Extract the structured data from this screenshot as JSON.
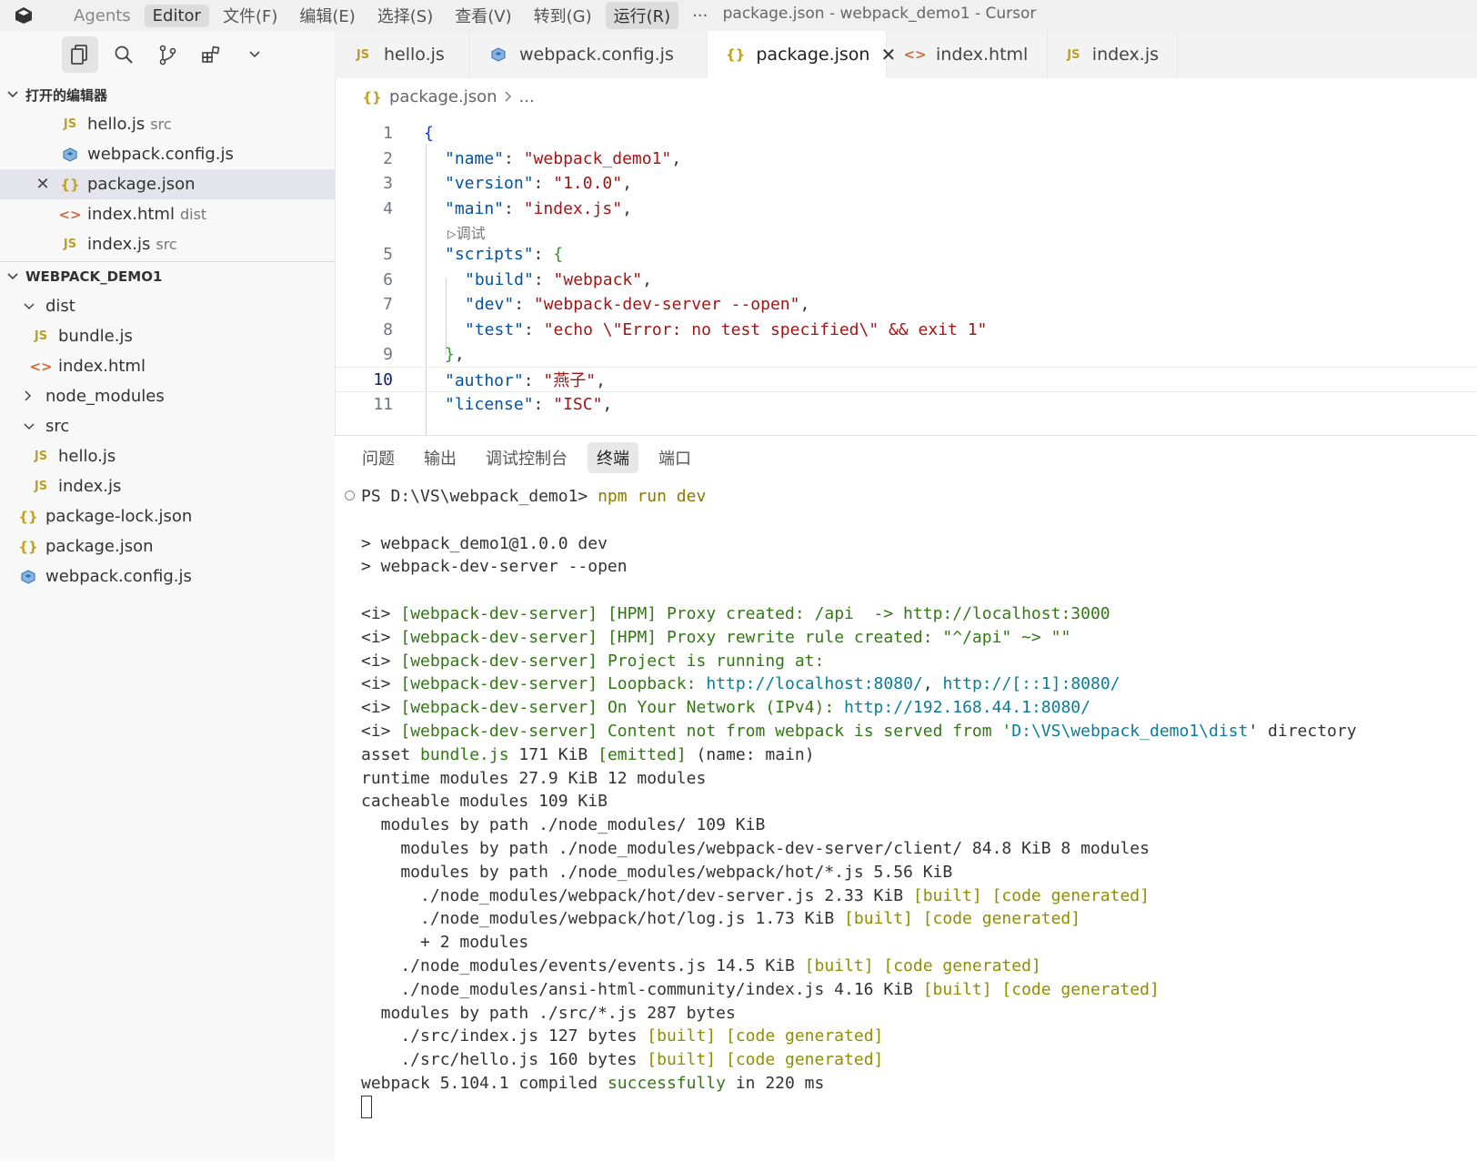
{
  "titlebar": {
    "menu": [
      "Agents",
      "Editor",
      "文件(F)",
      "编辑(E)",
      "选择(S)",
      "查看(V)",
      "转到(G)",
      "运行(R)",
      "···"
    ],
    "window_title": "package.json - webpack_demo1 - Cursor"
  },
  "sidebar": {
    "open_editors_title": "打开的编辑器",
    "open_editors": [
      {
        "name": "hello.js",
        "hint": "src"
      },
      {
        "name": "webpack.config.js",
        "hint": ""
      },
      {
        "name": "package.json",
        "hint": ""
      },
      {
        "name": "index.html",
        "hint": "dist"
      },
      {
        "name": "index.js",
        "hint": "src"
      }
    ],
    "project_title": "WEBPACK_DEMO1",
    "tree": [
      "dist",
      "bundle.js",
      "index.html",
      "node_modules",
      "src",
      "hello.js",
      "index.js",
      "package-lock.json",
      "package.json",
      "webpack.config.js"
    ]
  },
  "tabs": [
    "hello.js",
    "webpack.config.js",
    "package.json",
    "index.html",
    "index.js"
  ],
  "breadcrumb": {
    "file": "package.json",
    "rest": "..."
  },
  "editor": {
    "line_numbers": [
      "1",
      "2",
      "3",
      "4",
      "5",
      "6",
      "7",
      "8",
      "9",
      "10",
      "11"
    ],
    "codelens": "▷调试",
    "l1": "{",
    "l2_key": "\"name\"",
    "l2_val": "\"webpack_demo1\"",
    "l3_key": "\"version\"",
    "l3_val": "\"1.0.0\"",
    "l4_key": "\"main\"",
    "l4_val": "\"index.js\"",
    "l5_key": "\"scripts\"",
    "l5_brace": "{",
    "l6_key": "\"build\"",
    "l6_val": "\"webpack\"",
    "l7_key": "\"dev\"",
    "l7_val": "\"webpack-dev-server --open\"",
    "l8_key": "\"test\"",
    "l8_val": "\"echo \\\"Error: no test specified\\\" && exit 1\"",
    "l9": "}",
    "l10_key": "\"author\"",
    "l10_val": "\"燕子\"",
    "l11_key": "\"license\"",
    "l11_val": "\"ISC\""
  },
  "panel": {
    "tabs": [
      "问题",
      "输出",
      "调试控制台",
      "终端",
      "端口"
    ],
    "prompt": "PS D:\\VS\\webpack_demo1> ",
    "command": "npm run dev",
    "out1": "> webpack_demo1@1.0.0 dev",
    "out2": "> webpack-dev-server --open",
    "i": "<i> ",
    "wds": "[webpack-dev-server]",
    "hpm1": " [HPM] Proxy created: /api  -> http://localhost:3000",
    "hpm2": " [HPM] Proxy rewrite rule created: \"^/api\" ~> \"\"",
    "running": " Project is running at:",
    "loopback": " Loopback: ",
    "loop_url1": "http://localhost:8080/",
    "loop_sep": ", ",
    "loop_url2": "http://[::1]:8080/",
    "network": " On Your Network (IPv4): ",
    "net_url": "http://192.168.44.1:8080/",
    "content": " Content not from webpack is served from '",
    "content_path": "D:\\VS\\webpack_demo1\\dist",
    "content_end": "' directory",
    "asset_a": "asset ",
    "asset_file": "bundle.js",
    "asset_b": " 171 KiB ",
    "asset_emitted": "[emitted]",
    "asset_c": " (name: main)",
    "runtime": "runtime modules 27.9 KiB 12 modules",
    "cacheable": "cacheable modules 109 KiB",
    "m1": "  modules by path ./node_modules/ 109 KiB",
    "m2": "    modules by path ./node_modules/webpack-dev-server/client/ 84.8 KiB 8 modules",
    "m3": "    modules by path ./node_modules/webpack/hot/*.js 5.56 KiB",
    "m4": "      ./node_modules/webpack/hot/dev-server.js 2.33 KiB ",
    "m5": "      ./node_modules/webpack/hot/log.js 1.73 KiB ",
    "m6": "      + 2 modules",
    "m7": "    ./node_modules/events/events.js 14.5 KiB ",
    "m8": "    ./node_modules/ansi-html-community/index.js 4.16 KiB ",
    "m9": "  modules by path ./src/*.js 287 bytes",
    "m10": "    ./src/index.js 127 bytes ",
    "m11": "    ./src/hello.js 160 bytes ",
    "built": "[built] [code generated]",
    "done_a": "webpack 5.104.1 compiled ",
    "done_b": "successfully",
    "done_c": " in 220 ms"
  }
}
